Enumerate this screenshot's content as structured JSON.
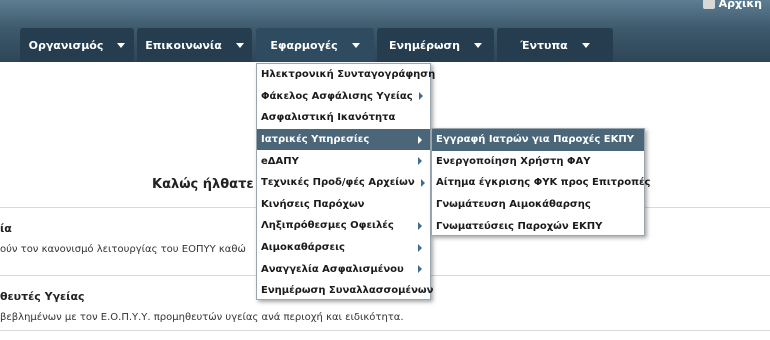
{
  "header": {
    "home_label": "Αρχική",
    "nav": [
      {
        "label": "Οργανισμός"
      },
      {
        "label": "Επικοινωνία"
      },
      {
        "label": "Εφαρμογές"
      },
      {
        "label": "Ενημέρωση"
      },
      {
        "label": "Έντυπα"
      }
    ]
  },
  "content": {
    "welcome": "Καλώς ήλθατε",
    "section1_title": "ία",
    "section1_text": "ούν τον κανονισμό λειτουργίας του ΕΟΠΥΥ καθώ",
    "section2_title": "θευτές Υγείας",
    "section2_text": "βεβλημένων με τον Ε.Ο.Π.Υ.Υ. προμηθευτών υγείας ανά περιοχή και ειδικότητα."
  },
  "apps_menu": [
    "Ηλεκτρονική Συνταγογράφηση",
    "Φάκελος Ασφάλισης Υγείας",
    "Ασφαλιστική Ικανότητα",
    "Ιατρικές Υπηρεσίες",
    "eΔΑΠΥ",
    "Τεχνικές Προδ/φές Αρχείων",
    "Κινήσεις Παρόχων",
    "Ληξιπρόθεσμες Οφειλές",
    "Αιμοκαθάρσεις",
    "Αναγγελία Ασφαλισμένου",
    "Ενημέρωση Συναλλασσομένων"
  ],
  "medical_submenu": [
    "Εγγραφή Ιατρών για Παροχές ΕΚΠΥ",
    "Ενεργοποίηση Χρήστη ΦΑΥ",
    "Αίτημα έγκρισης ΦΥΚ προς Επιτροπές",
    "Γνωμάτευση Αιμοκάθαρσης",
    "Γνωματεύσεις Παροχών ΕΚΠΥ"
  ]
}
